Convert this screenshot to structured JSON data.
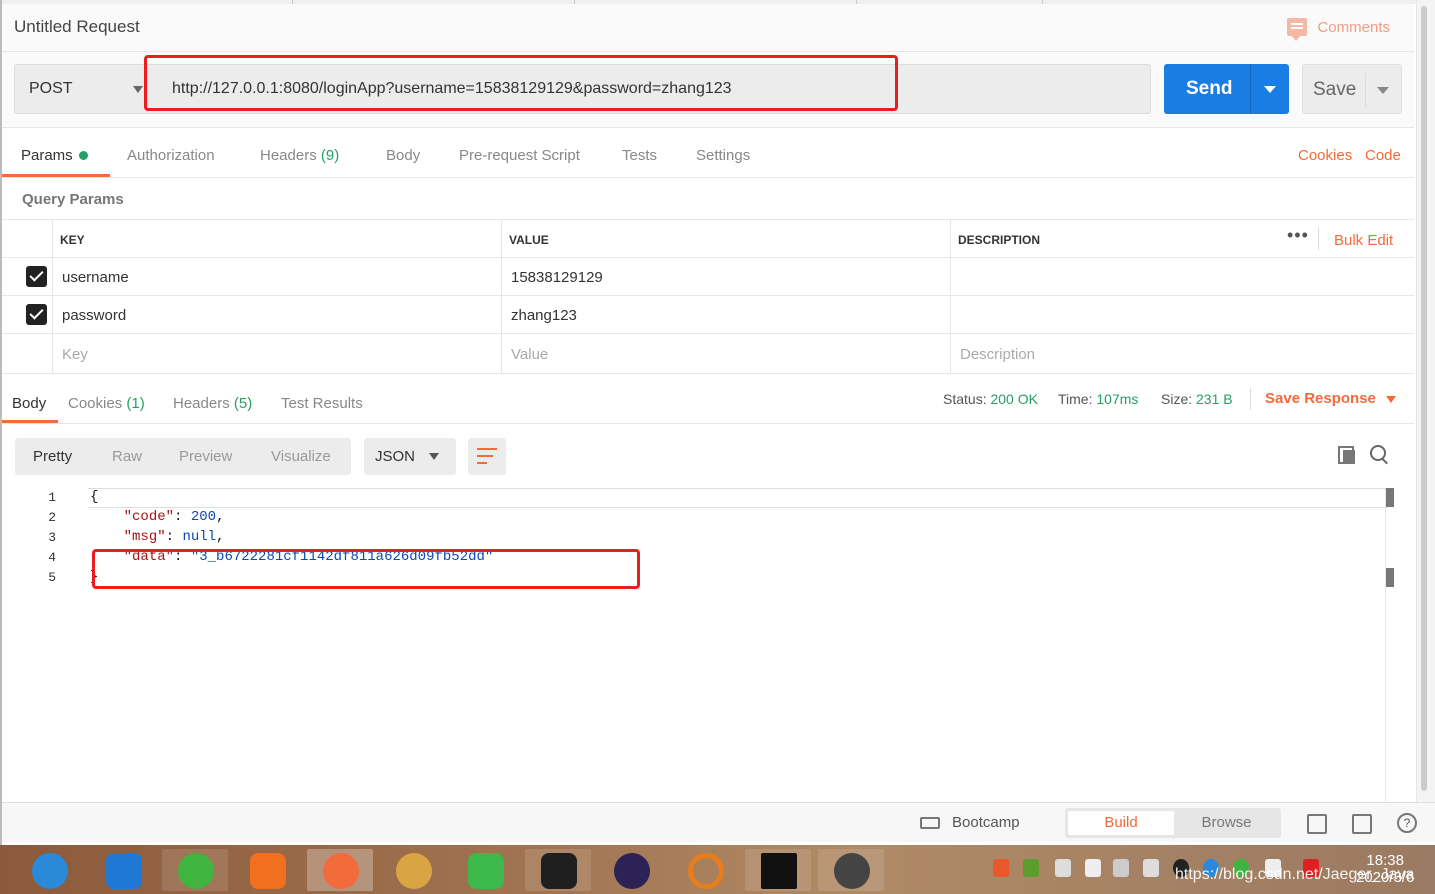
{
  "request": {
    "title": "Untitled Request",
    "comments_label": "Comments",
    "method": "POST",
    "url": "http://127.0.0.1:8080/loginApp?username=15838129129&password=zhang123",
    "send_label": "Send",
    "save_label": "Save"
  },
  "request_tabs": {
    "params": "Params",
    "authorization": "Authorization",
    "headers": "Headers",
    "headers_count": "(9)",
    "body": "Body",
    "pre_request": "Pre-request Script",
    "tests": "Tests",
    "settings": "Settings",
    "cookies": "Cookies",
    "code": "Code"
  },
  "query_params": {
    "label": "Query Params",
    "columns": {
      "key": "KEY",
      "value": "VALUE",
      "description": "DESCRIPTION"
    },
    "bulk_edit": "Bulk Edit",
    "more": "•••",
    "rows": [
      {
        "key": "username",
        "value": "15838129129",
        "description": ""
      },
      {
        "key": "password",
        "value": "zhang123",
        "description": ""
      }
    ],
    "placeholders": {
      "key": "Key",
      "value": "Value",
      "description": "Description"
    }
  },
  "response": {
    "tabs": {
      "body": "Body",
      "cookies": "Cookies",
      "cookies_count": "(1)",
      "headers": "Headers",
      "headers_count": "(5)",
      "test_results": "Test Results"
    },
    "status_label": "Status:",
    "status_value": "200 OK",
    "time_label": "Time:",
    "time_value": "107ms",
    "size_label": "Size:",
    "size_value": "231 B",
    "save_response": "Save Response",
    "view_modes": [
      "Pretty",
      "Raw",
      "Preview",
      "Visualize"
    ],
    "format": "JSON",
    "line_numbers": [
      "1",
      "2",
      "3",
      "4",
      "5"
    ],
    "code": {
      "open": "{",
      "code_key": "\"code\"",
      "code_val": "200",
      "msg_key": "\"msg\"",
      "msg_val": "null",
      "data_key": "\"data\"",
      "data_val": "\"3_b6722281cf1142df811a626d09fb52dd\"",
      "close": "}"
    }
  },
  "bottom_bar": {
    "bootcamp": "Bootcamp",
    "build": "Build",
    "browse": "Browse",
    "help": "?"
  },
  "taskbar": {
    "time": "18:38",
    "date": "2020/3/6",
    "watermark": "https://blog.csdn.net/Jaeger_Java"
  },
  "colors": {
    "accent": "#f26b3a",
    "send_blue": "#1a7de3",
    "success_green": "#25a065",
    "annotation_red": "#ee1c1c"
  }
}
